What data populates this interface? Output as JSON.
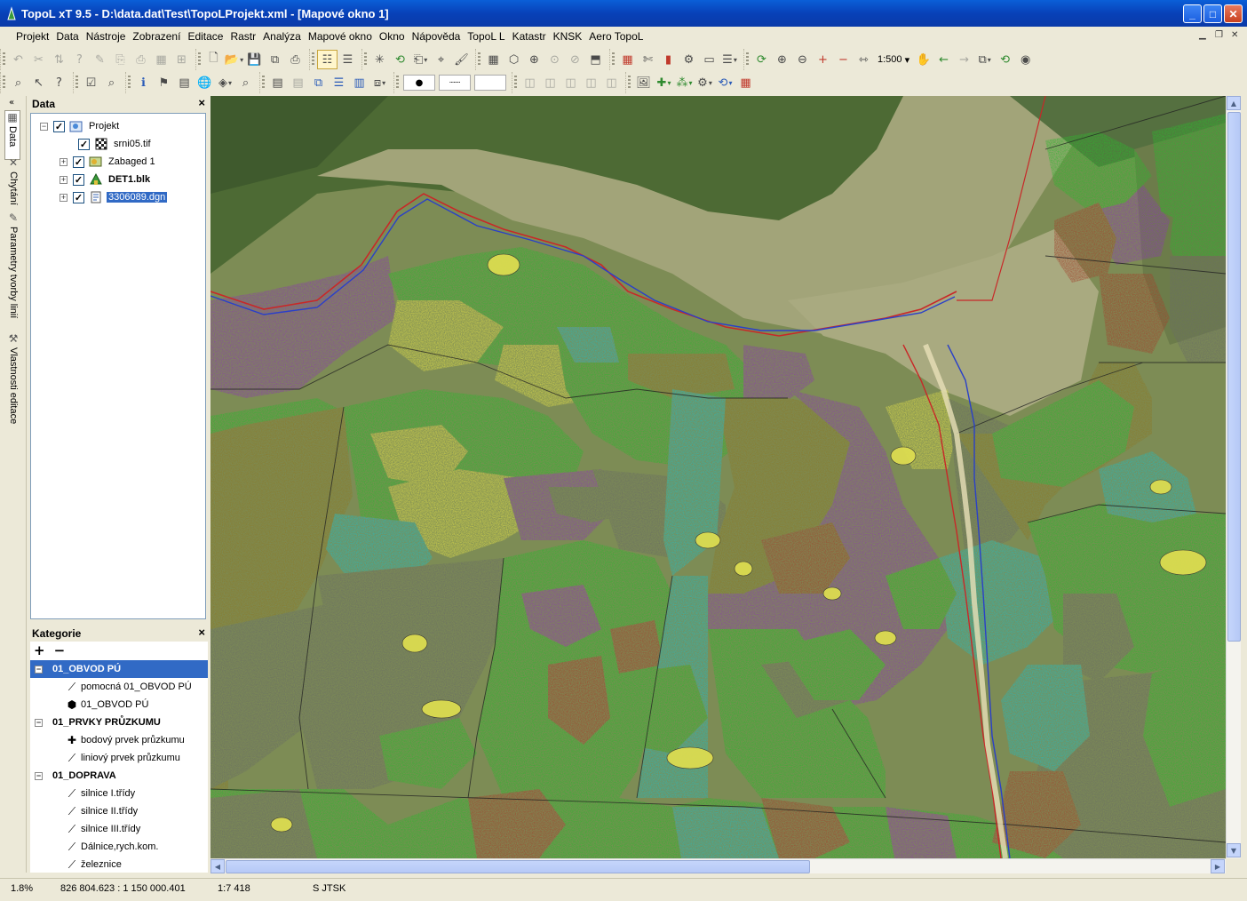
{
  "window": {
    "title": "TopoL xT 9.5 - D:\\data.dat\\Test\\TopoLProjekt.xml - [Mapové okno 1]"
  },
  "menu": [
    "Projekt",
    "Data",
    "Nástroje",
    "Zobrazení",
    "Editace",
    "Rastr",
    "Analýza",
    "Mapové okno",
    "Okno",
    "Nápověda",
    "TopoL L",
    "Katastr",
    "KNSK",
    "Aero TopoL"
  ],
  "toolbar": {
    "scale": "1:500"
  },
  "dock_tabs": [
    "Data",
    "Chytání",
    "Parametry tvorby linií",
    "Vlastnosti editace"
  ],
  "data_panel": {
    "title": "Data",
    "tree": [
      {
        "label": "Projekt",
        "icon": "project-icon",
        "checked": true
      },
      {
        "label": "srni05.tif",
        "icon": "raster-icon",
        "checked": true
      },
      {
        "label": "Zabaged 1",
        "icon": "vector-icon",
        "checked": true
      },
      {
        "label": "DET1.blk",
        "icon": "block-icon",
        "checked": true,
        "bold": true
      },
      {
        "label": "3306089.dgn",
        "icon": "dgn-icon",
        "checked": true,
        "selected": true
      }
    ]
  },
  "category_panel": {
    "title": "Kategorie",
    "add": "+",
    "remove": "−",
    "groups": [
      {
        "label": "01_OBVOD PÚ",
        "items": [
          "pomocná 01_OBVOD PÚ",
          "01_OBVOD PÚ"
        ]
      },
      {
        "label": "01_PRVKY PRŮZKUMU",
        "items": [
          "bodový prvek průzkumu",
          "liniový prvek průzkumu"
        ]
      },
      {
        "label": "01_DOPRAVA",
        "items": [
          "silnice I.třídy",
          "silnice II.třídy",
          "silnice III.třídy",
          "Dálnice,rych.kom.",
          "železnice"
        ]
      }
    ]
  },
  "statusbar": {
    "progress": "1.8%",
    "coordinates": "826 804.623 : 1 150 000.401",
    "scale": "1:7 418",
    "crs": "S JTSK"
  },
  "colors": {
    "green": "#2fb52f",
    "purple": "#8a3fa8",
    "cyan": "#2ab8b8",
    "yellow": "#d8d84a",
    "olive": "#8a7a2a",
    "gray": "#6a6e62",
    "brown": "#a0452e",
    "orthophoto": "#8a9a60"
  }
}
